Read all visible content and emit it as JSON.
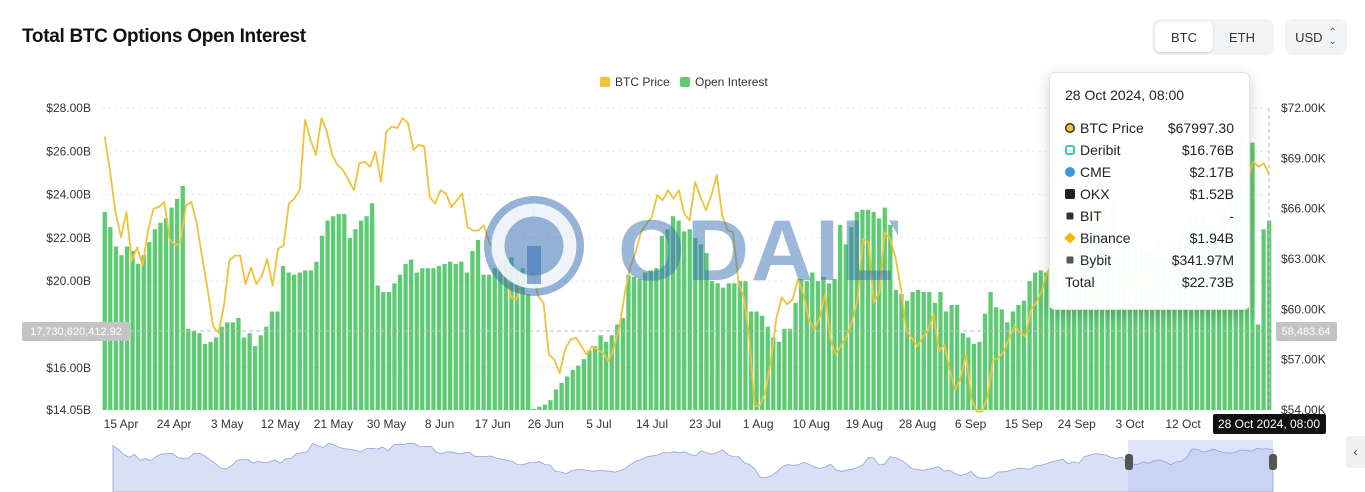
{
  "header": {
    "title": "Total BTC Options Open Interest",
    "asset_tabs": [
      {
        "label": "BTC",
        "active": true
      },
      {
        "label": "ETH",
        "active": false
      }
    ],
    "currency": "USD"
  },
  "legend": [
    {
      "label": "BTC Price",
      "color": "#f0c23a"
    },
    {
      "label": "Open Interest",
      "color": "#5ccb72"
    }
  ],
  "left_axis_ticks": [
    "$28.00B",
    "$26.00B",
    "$24.00B",
    "$22.00B",
    "$20.00B",
    "$16.00B",
    "$14.05B"
  ],
  "right_axis_ticks": [
    "$72.00K",
    "$69.00K",
    "$66.00K",
    "$63.00K",
    "$60.00K",
    "$57.00K",
    "$54.00K"
  ],
  "x_axis_ticks": [
    "15 Apr",
    "24 Apr",
    "3 May",
    "12 May",
    "21 May",
    "30 May",
    "8 Jun",
    "17 Jun",
    "26 Jun",
    "5 Jul",
    "14 Jul",
    "23 Jul",
    "1 Aug",
    "10 Aug",
    "19 Aug",
    "28 Aug",
    "6 Sep",
    "15 Sep",
    "24 Sep",
    "3 Oct",
    "12 Oct"
  ],
  "crosshair": {
    "left_label": "17,730,620,412.92",
    "right_label": "58,483.64",
    "x_label": "28 Oct 2024, 08:00"
  },
  "tooltip": {
    "title": "28 Oct 2024, 08:00",
    "rows": [
      {
        "name": "BTC Price",
        "value": "$67997.30",
        "icon": "circle-icon",
        "color": "#f0c23a"
      },
      {
        "name": "Deribit",
        "value": "$16.76B",
        "icon": "deribit-icon",
        "color": "#3bc6b0"
      },
      {
        "name": "CME",
        "value": "$2.17B",
        "icon": "cme-icon",
        "color": "#3a9ad9"
      },
      {
        "name": "OKX",
        "value": "$1.52B",
        "icon": "okx-icon",
        "color": "#222222"
      },
      {
        "name": "BIT",
        "value": "-",
        "icon": "bit-icon",
        "color": "#333333"
      },
      {
        "name": "Binance",
        "value": "$1.94B",
        "icon": "binance-icon",
        "color": "#f0b90b"
      },
      {
        "name": "Bybit",
        "value": "$341.97M",
        "icon": "bybit-icon",
        "color": "#555555"
      },
      {
        "name": "Total",
        "value": "$22.73B",
        "icon": "",
        "color": ""
      }
    ]
  },
  "watermark": "ODAILY",
  "chart_data": {
    "type": "bar",
    "x_range": [
      "2024-04-12",
      "2024-10-28"
    ],
    "series": [
      {
        "name": "Open Interest",
        "unit": "USD billions",
        "axis": "left",
        "values": [
          23.2,
          22.5,
          21.6,
          21.2,
          21.6,
          21.4,
          20.8,
          21.2,
          21.8,
          22.4,
          22.7,
          22.9,
          23.4,
          23.8,
          24.4,
          17.8,
          17.7,
          17.6,
          17.1,
          17.2,
          17.4,
          17.9,
          18.1,
          18.1,
          18.3,
          17.4,
          17.6,
          17.0,
          17.5,
          17.9,
          18.6,
          18.6,
          20.7,
          20.4,
          20.3,
          20.4,
          20.5,
          20.5,
          20.9,
          22.1,
          22.8,
          23.0,
          23.1,
          23.1,
          22.0,
          22.4,
          22.8,
          23.0,
          23.6,
          19.8,
          19.5,
          19.5,
          19.9,
          20.3,
          20.8,
          21.0,
          20.4,
          20.6,
          20.6,
          20.6,
          20.7,
          20.8,
          20.9,
          20.8,
          20.9,
          20.4,
          21.4,
          21.9,
          20.3,
          20.3,
          20.6,
          20.7,
          21.0,
          21.1,
          20.4,
          20.6,
          19.4,
          14.1,
          14.2,
          14.3,
          14.5,
          15.0,
          15.3,
          15.6,
          15.9,
          16.1,
          16.4,
          16.8,
          17.0,
          17.5,
          17.2,
          17.5,
          18.0,
          18.3,
          20.3,
          20.2,
          20.1,
          20.4,
          20.5,
          20.6,
          22.1,
          22.4,
          23.0,
          22.8,
          22.3,
          22.4,
          22.0,
          21.7,
          21.3,
          20.0,
          19.9,
          19.7,
          19.9,
          19.9,
          20.0,
          20.0,
          18.6,
          18.6,
          18.4,
          17.9,
          17.4,
          17.2,
          17.8,
          17.8,
          19.0,
          20.1,
          20.0,
          20.4,
          20.0,
          20.2,
          19.9,
          20.1,
          22.6,
          21.7,
          22.5,
          23.2,
          23.3,
          23.3,
          23.2,
          22.9,
          23.4,
          22.6,
          19.6,
          19.4,
          19.1,
          19.5,
          19.6,
          19.5,
          19.5,
          19.0,
          19.5,
          18.6,
          18.9,
          18.9,
          17.6,
          17.4,
          17.1,
          17.2,
          18.5,
          19.5,
          18.8,
          18.7,
          18.1,
          18.6,
          18.9,
          19.1,
          20.0,
          20.4,
          20.5,
          20.4,
          20.8,
          20.7,
          20.8,
          20.9,
          21.3,
          21.7,
          22.3,
          23.6,
          23.4,
          23.3,
          22.8,
          23.7,
          21.8,
          22.0,
          21.8,
          21.7,
          21.5,
          21.3,
          21.6,
          21.9,
          21.1,
          21.3,
          21.8,
          22.1,
          22.6,
          22.9,
          23.1,
          23.1,
          22.6,
          22.7,
          22.1,
          23.4,
          23.9,
          24.2,
          26.7,
          26.4,
          26.4,
          18.0,
          22.4,
          22.8
        ]
      },
      {
        "name": "BTC Price",
        "unit": "USD thousands",
        "axis": "right",
        "values": [
          70.3,
          68.2,
          65.8,
          64.3,
          65.8,
          62.9,
          63.7,
          62.6,
          64.7,
          66.0,
          66.1,
          66.4,
          64.2,
          63.8,
          64.0,
          66.2,
          66.4,
          65.1,
          63.1,
          61.2,
          59.0,
          58.6,
          60.2,
          62.9,
          63.2,
          63.2,
          61.5,
          62.5,
          61.5,
          62.0,
          63.0,
          61.4,
          63.6,
          63.8,
          66.3,
          66.6,
          67.1,
          71.3,
          70.1,
          69.2,
          71.4,
          70.6,
          69.2,
          68.6,
          68.3,
          67.7,
          67.1,
          68.7,
          68.8,
          68.5,
          69.4,
          67.6,
          70.6,
          70.9,
          70.8,
          71.4,
          71.1,
          69.5,
          69.8,
          69.7,
          66.7,
          66.3,
          67.1,
          66.9,
          66.1,
          66.5,
          66.9,
          64.9,
          64.7,
          64.7,
          65.0,
          64.0,
          63.4,
          62.8,
          62.3,
          60.7,
          60.6,
          61.6,
          61.7,
          62.2,
          60.8,
          60.4,
          57.3,
          57.0,
          56.2,
          57.6,
          58.2,
          58.3,
          57.8,
          57.3,
          57.8,
          57.6,
          57.4,
          56.9,
          57.7,
          58.9,
          60.9,
          62.5,
          63.4,
          64.6,
          65.1,
          65.5,
          66.8,
          66.5,
          67.1,
          66.6,
          67.1,
          65.7,
          65.3,
          67.6,
          66.7,
          65.9,
          66.8,
          68.0,
          65.6,
          64.7,
          64.6,
          61.6,
          60.7,
          58.3,
          54.2,
          54.3,
          55.1,
          57.0,
          59.5,
          60.7,
          60.3,
          60.6,
          61.8,
          60.9,
          59.4,
          58.8,
          59.5,
          60.9,
          58.2,
          57.3,
          57.9,
          58.4,
          59.3,
          60.6,
          64.2,
          64.0,
          60.4,
          61.0,
          64.6,
          64.2,
          63.1,
          61.2,
          58.7,
          58.3,
          57.8,
          58.3,
          58.8,
          59.7,
          57.5,
          57.9,
          56.4,
          55.2,
          55.9,
          57.3,
          54.7,
          53.9,
          53.9,
          54.8,
          57.0,
          57.1,
          57.5,
          58.3,
          59.0,
          58.6,
          58.4,
          60.0,
          60.4,
          61.1,
          62.2,
          62.7,
          63.4,
          61.1,
          62.1,
          61.4,
          64.7,
          65.3,
          66.1,
          65.9,
          65.5,
          64.3,
          63.8,
          64.4,
          60.8,
          60.9,
          60.8,
          62.1,
          61.3,
          62.8,
          63.0,
          62.1,
          60.6,
          62.0,
          62.3,
          64.3,
          68.5,
          68.3,
          67.0,
          67.5,
          68.5,
          67.4,
          66.7,
          66.4,
          66.8,
          68.0,
          67.9,
          67.4,
          68.8,
          68.5,
          68.7,
          68.0
        ]
      }
    ],
    "y_left_range": [
      14.05,
      28.0
    ],
    "y_right_range": [
      54.0,
      72.0
    ],
    "xlabel": "",
    "ylabel": ""
  }
}
